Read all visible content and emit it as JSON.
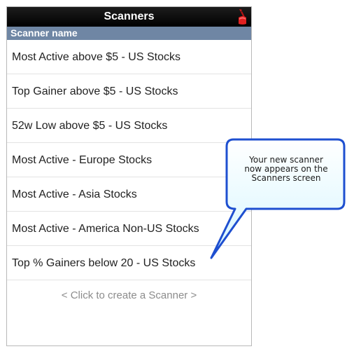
{
  "header": {
    "title": "Scanners"
  },
  "column_header": "Scanner name",
  "scanners": [
    "Most Active above $5 - US Stocks",
    "Top Gainer above $5 - US Stocks",
    "52w Low above $5 - US Stocks",
    "Most Active - Europe Stocks",
    "Most Active - Asia Stocks",
    "Most Active - America Non-US Stocks",
    "Top % Gainers below 20 - US Stocks"
  ],
  "create_prompt": "< Click to create a Scanner >",
  "callout": {
    "lines": [
      "Your new scanner",
      "now appears on the",
      "Scanners screen"
    ]
  },
  "colors": {
    "title_bar": "#000000",
    "column_header_bg": "#6f86a4",
    "callout_border": "#1e4fd0",
    "callout_fill": "#e4fbff"
  },
  "icons": {
    "title_right": "red-flag-icon"
  }
}
